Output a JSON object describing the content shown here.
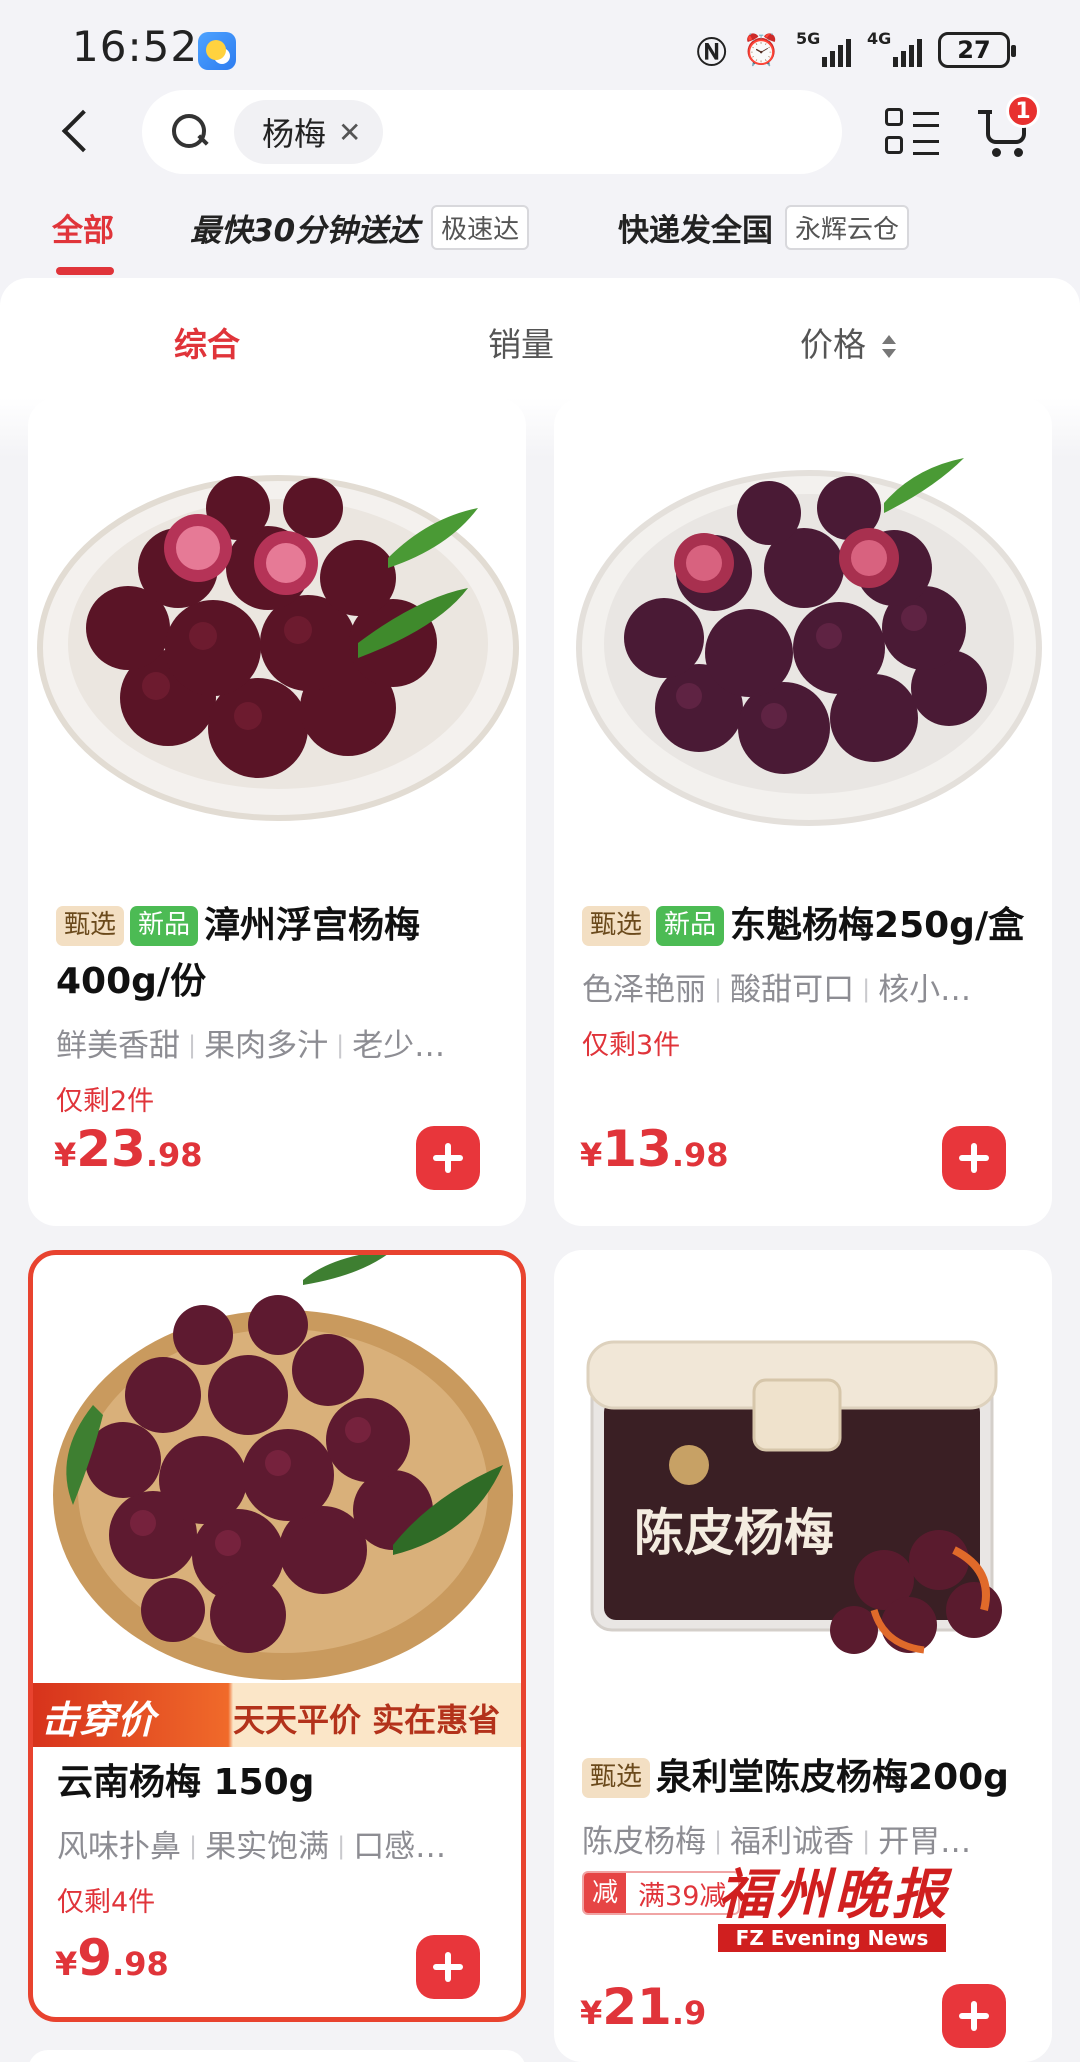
{
  "status_bar": {
    "time": "16:52",
    "network_1": "5G",
    "network_2": "4G",
    "battery": "27",
    "icons": [
      "weather-icon",
      "nfc-icon",
      "alarm-icon",
      "signal-icon",
      "battery-icon"
    ]
  },
  "header": {
    "search_query": "杨梅",
    "cart_count": "1",
    "icons": [
      "back-icon",
      "search-icon",
      "close-icon",
      "list-layout-icon",
      "cart-icon"
    ]
  },
  "filter_tabs": [
    {
      "label": "全部",
      "tag": ""
    },
    {
      "label": "最快30分钟送达",
      "tag": "极速达"
    },
    {
      "label": "快递发全国",
      "tag": "永辉云仓"
    }
  ],
  "sort": [
    {
      "label": "综合"
    },
    {
      "label": "销量"
    },
    {
      "label": "价格"
    }
  ],
  "products": [
    {
      "badges": [
        "甄选",
        "新品"
      ],
      "title": "漳州浮宫杨梅400g/份",
      "features": [
        "鲜美香甜",
        "果肉多汁",
        "老少…"
      ],
      "stock": "仅剩2件",
      "price_symbol": "¥",
      "price_int": "23",
      "price_dec": ".98"
    },
    {
      "badges": [
        "甄选",
        "新品"
      ],
      "title": "东魁杨梅250g/盒",
      "features": [
        "色泽艳丽",
        "酸甜可口",
        "核小…"
      ],
      "stock": "仅剩3件",
      "price_symbol": "¥",
      "price_int": "13",
      "price_dec": ".98"
    },
    {
      "badges": [],
      "title": "云南杨梅 150g",
      "features": [
        "风味扑鼻",
        "果实饱满",
        "口感…"
      ],
      "stock": "仅剩4件",
      "price_symbol": "¥",
      "price_int": "9",
      "price_dec": ".98",
      "promo_left": "击穿价",
      "promo_right": "天天平价 实在惠省"
    },
    {
      "badges": [
        "甄选"
      ],
      "title": "泉利堂陈皮杨梅200g",
      "features": [
        "陈皮杨梅",
        "福利诚香",
        "开胃…"
      ],
      "coupon_key": "减",
      "coupon_value": "满39减",
      "price_symbol": "¥",
      "price_int": "21",
      "price_dec": ".9",
      "package_text": "陈皮杨梅"
    }
  ],
  "watermark": {
    "cn": "福州晚报",
    "en": "FZ Evening News"
  },
  "colors": {
    "accent": "#e0343a",
    "badge_new": "#4cbb54",
    "badge_select": "#f3dfc3"
  }
}
